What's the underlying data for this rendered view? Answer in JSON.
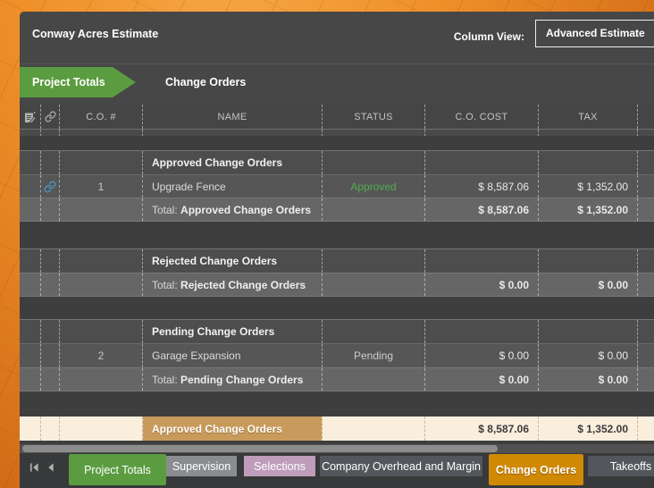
{
  "window": {
    "title": "Conway Acres Estimate"
  },
  "toolbar": {
    "column_view_label": "Column View:",
    "column_view_value": "Advanced Estimate"
  },
  "breadcrumb": {
    "root": "Project Totals",
    "current": "Change Orders"
  },
  "table": {
    "headers": {
      "co_num": "C.O. #",
      "name": "NAME",
      "status": "STATUS",
      "cost": "C.O. COST",
      "tax": "TAX"
    },
    "groups": [
      {
        "title": "Approved Change Orders",
        "rows": [
          {
            "num": "1",
            "name": "Upgrade Fence",
            "status": "Approved",
            "cost": "$ 8,587.06",
            "tax": "$ 1,352.00",
            "has_link": true
          }
        ],
        "total": {
          "prefix": "Total: ",
          "title": "Approved Change Orders",
          "cost": "$ 8,587.06",
          "tax": "$ 1,352.00"
        }
      },
      {
        "title": "Rejected Change Orders",
        "rows": [],
        "total": {
          "prefix": "Total: ",
          "title": "Rejected Change Orders",
          "cost": "$ 0.00",
          "tax": "$ 0.00"
        }
      },
      {
        "title": "Pending Change Orders",
        "rows": [
          {
            "num": "2",
            "name": "Garage Expansion",
            "status": "Pending",
            "cost": "$ 0.00",
            "tax": "$ 0.00",
            "has_link": false
          }
        ],
        "total": {
          "prefix": "Total: ",
          "title": "Pending Change Orders",
          "cost": "$ 0.00",
          "tax": "$ 0.00"
        }
      }
    ],
    "summary": {
      "label": "Approved Change Orders",
      "cost": "$ 8,587.06",
      "tax": "$ 1,352.00"
    }
  },
  "sheet_tabs": [
    {
      "label": "Project Totals",
      "color": "#5b9c41",
      "active": true
    },
    {
      "label": "Supervision",
      "color": "#8a8d90",
      "active": false
    },
    {
      "label": "Selections",
      "color": "#bd9dba",
      "active": false
    },
    {
      "label": "Company Overhead and Margin",
      "color": "#53565a",
      "active": false
    },
    {
      "label": "Change Orders",
      "color": "#d08903",
      "active": true
    },
    {
      "label": "Takeoffs",
      "color": "#53565a",
      "active": false
    }
  ],
  "icons": {
    "edit_form": "edit-form-icon",
    "link": "link-icon",
    "first_page": "first-page-icon",
    "previous": "previous-icon"
  },
  "colors": {
    "panel_bg": "#474747",
    "frame_orange": "#ef9029",
    "accent_green": "#5b9c41",
    "status_approved_green": "#4fae4f",
    "link_blue": "#4e8fbe",
    "summary_tan": "#c89b5c",
    "summary_cream": "#faeedd",
    "active_tab_orange": "#d08903"
  }
}
